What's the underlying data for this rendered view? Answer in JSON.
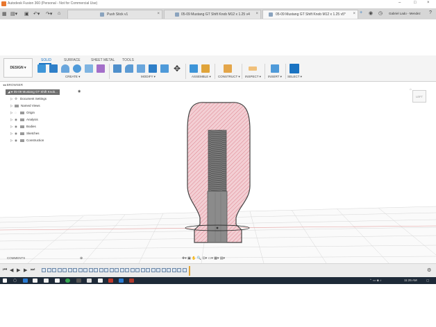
{
  "window": {
    "title": "Autodesk Fusion 360 (Personal - Not for Commercial Use)",
    "minimize": "–",
    "maximize": "□",
    "close": "×"
  },
  "tabs": [
    {
      "label": "Push Stick v1",
      "active": false
    },
    {
      "label": "05-09 Mustang GT Shift Knob M12 x 1.25 v4",
      "active": false
    },
    {
      "label": "05-09 Mustang GT Shift Knob M12 x 1.25 v5*",
      "active": true
    }
  ],
  "user": {
    "name": "Gabriel Lado - Mendez"
  },
  "toolbar": {
    "workspace_button": "DESIGN ▾",
    "tabs": [
      "SOLID",
      "SURFACE",
      "SHEET METAL",
      "TOOLS"
    ],
    "active_tab": "SOLID",
    "groups": [
      "CREATE ▾",
      "MODIFY ▾",
      "ASSEMBLE ▾",
      "CONSTRUCT ▾",
      "INSPECT ▾",
      "INSERT ▾",
      "SELECT ▾"
    ]
  },
  "browser": {
    "header": "BROWSER",
    "root": "05-09 Mustang GT Shift Knob...",
    "items": [
      "Document Settings",
      "Named Views",
      "Origin",
      "Analysis",
      "Bodies",
      "Sketches",
      "Construction"
    ]
  },
  "viewcube": {
    "label": "LEFT"
  },
  "comments": {
    "label": "COMMENTS"
  },
  "taskbar": {
    "time": "11:25 AM"
  },
  "colors": {
    "section_fill": "#f3cfd4",
    "hatch": "#d9707d",
    "thread": "#6a6a6a",
    "shaft": "#8b8b8b",
    "accent": "#1a73c2",
    "taskbar": "#1e2a38"
  }
}
